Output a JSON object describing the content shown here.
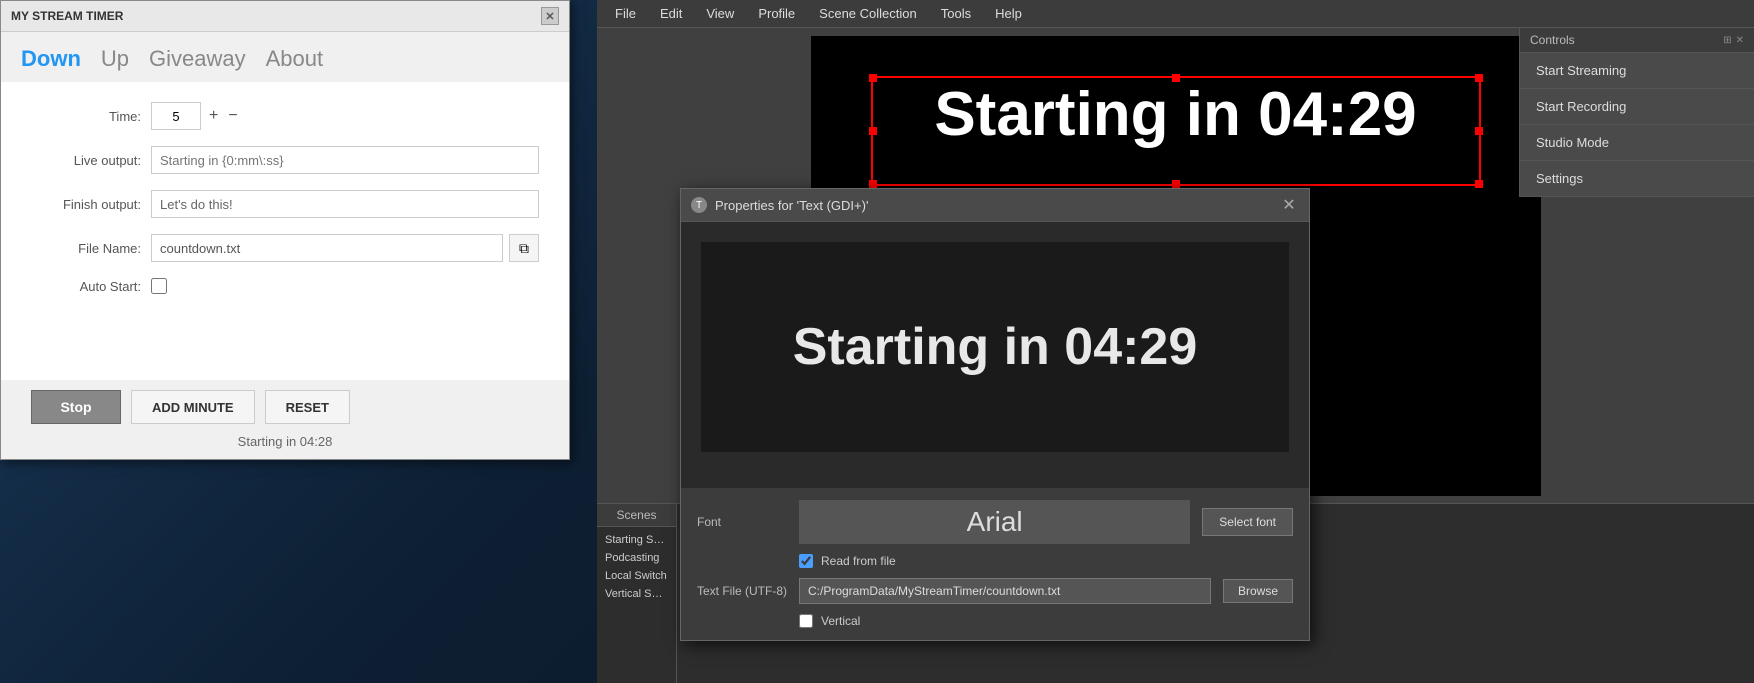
{
  "timer_window": {
    "title": "MY STREAM TIMER",
    "nav_items": [
      {
        "label": "Down",
        "active": true
      },
      {
        "label": "Up",
        "active": false
      },
      {
        "label": "Giveaway",
        "active": false
      },
      {
        "label": "About",
        "active": false
      }
    ],
    "time_label": "Time:",
    "time_value": "5",
    "live_output_label": "Live output:",
    "live_output_placeholder": "Starting in {0:mm\\:ss}",
    "finish_output_label": "Finish output:",
    "finish_output_value": "Let's do this!",
    "file_name_label": "File Name:",
    "file_name_value": "countdown.txt",
    "auto_start_label": "Auto Start:",
    "btn_stop": "Stop",
    "btn_add_minute": "ADD MINUTE",
    "btn_reset": "RESET",
    "status_text": "Starting in 04:28"
  },
  "obs": {
    "menu_items": [
      "File",
      "Edit",
      "View",
      "Profile",
      "Scene Collection",
      "Tools",
      "Help"
    ],
    "preview_text": "Starting in 04:29",
    "scenes": {
      "header": "Scenes",
      "items": [
        "Starting Soc...",
        "Podcasting",
        "Local Switch",
        "Vertical Swit..."
      ]
    }
  },
  "properties_dialog": {
    "title": "Properties for 'Text (GDI+)'",
    "preview_text": "Starting in 04:29",
    "font_label": "Font",
    "font_name": "Arial",
    "select_font_btn": "Select font",
    "read_from_file_label": "Read from file",
    "text_file_label": "Text File (UTF-8)",
    "text_file_value": "C:/ProgramData/MyStreamTimer/countdown.txt",
    "browse_btn": "Browse",
    "vertical_label": "Vertical"
  },
  "controls_panel": {
    "header": "Controls",
    "btn_start_streaming": "Start Streaming",
    "btn_start_recording": "Start Recording",
    "btn_studio_mode": "Studio Mode",
    "btn_settings": "Settings"
  }
}
